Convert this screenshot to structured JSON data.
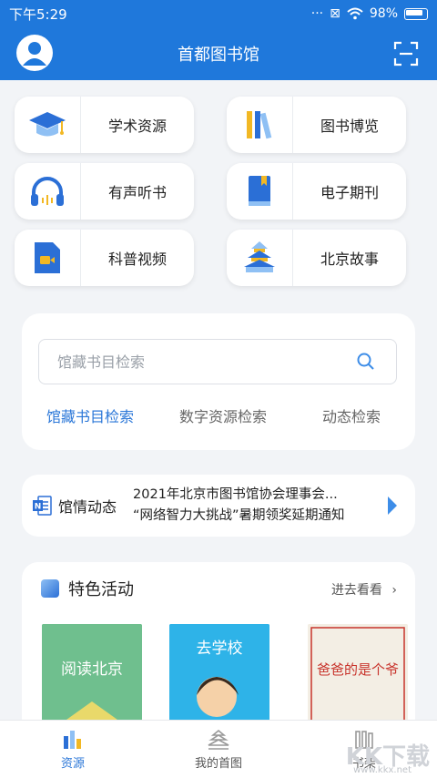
{
  "status": {
    "time": "下午5:29",
    "battery": "98%"
  },
  "header": {
    "title": "首都图书馆"
  },
  "tiles": [
    {
      "label": "学术资源"
    },
    {
      "label": "图书博览"
    },
    {
      "label": "有声听书"
    },
    {
      "label": "电子期刊"
    },
    {
      "label": "科普视频"
    },
    {
      "label": "北京故事"
    }
  ],
  "search": {
    "placeholder": "馆藏书目检索",
    "tabs": [
      "馆藏书目检索",
      "数字资源检索",
      "动态检索"
    ]
  },
  "news": {
    "label": "馆情动态",
    "lines": [
      "2021年北京市图书馆协会理事会...",
      "“网络智力大挑战”暑期领奖延期通知"
    ]
  },
  "activity": {
    "title": "特色活动",
    "more": "进去看看",
    "books": [
      {
        "cover_text": "阅读北京"
      },
      {
        "cover_text": "去学校"
      },
      {
        "cover_text": "爸爸的是个爷"
      }
    ]
  },
  "tabbar": {
    "items": [
      {
        "label": "资源"
      },
      {
        "label": "我的首图"
      },
      {
        "label": "书架"
      }
    ]
  },
  "watermark": {
    "text": "KK下载",
    "sub": "www.kkx.net"
  },
  "colors": {
    "primary": "#1f78db",
    "accent": "#3d8de8"
  }
}
